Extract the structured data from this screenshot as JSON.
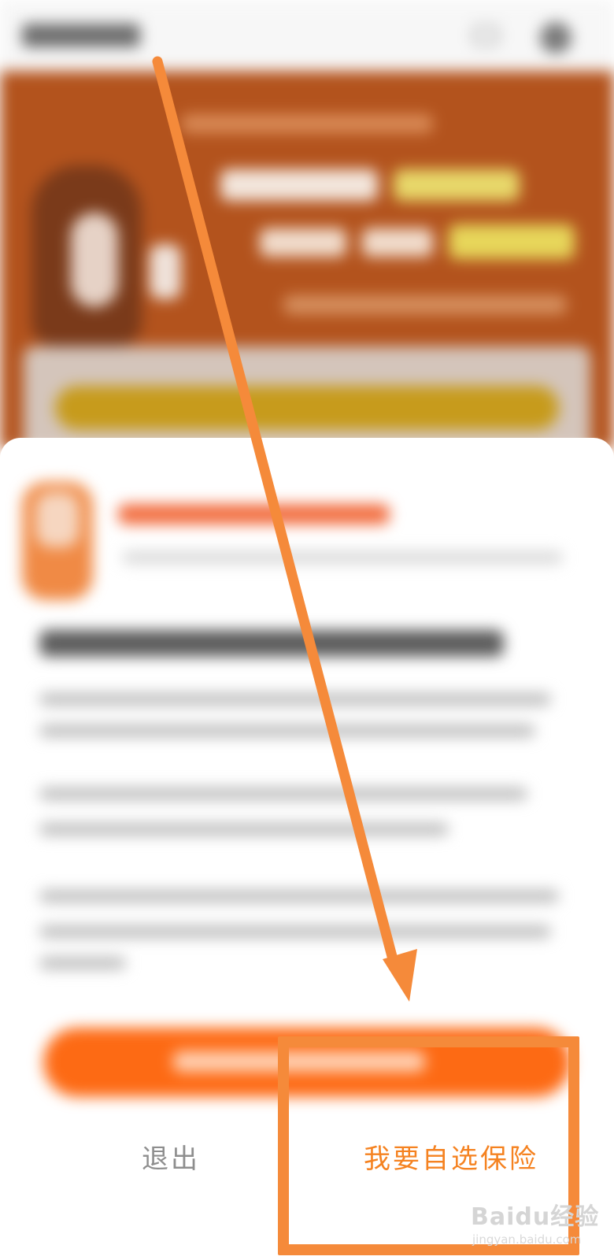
{
  "actions": {
    "exit_label": "退出",
    "choose_label": "我要自选保险"
  },
  "watermark": {
    "brand": "Baidu经验",
    "url": "jingyan.baidu.com"
  },
  "colors": {
    "accent_orange": "#f58220",
    "annotation_orange": "#f58a3a",
    "banner_brown": "#b3531d",
    "cta_orange": "#fd6a14"
  }
}
